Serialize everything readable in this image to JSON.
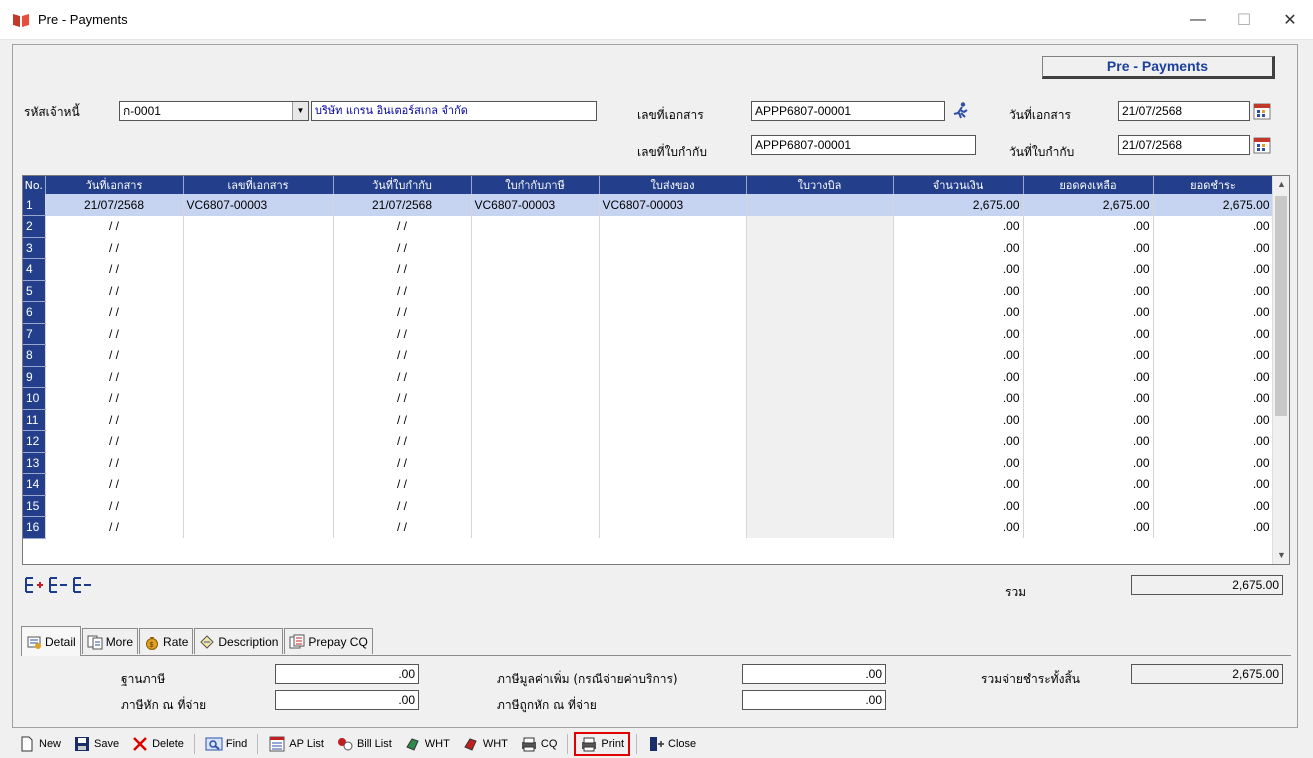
{
  "window": {
    "title": "Pre - Payments",
    "minimize": "—",
    "maximize": "☐",
    "close": "✕"
  },
  "header": {
    "badge": "Pre - Payments"
  },
  "form": {
    "creditor_code_label": "รหัสเจ้าหนี้",
    "creditor_code": "ก-0001",
    "creditor_name": "บริษัท แกรน อินเตอร์สเกล จำกัด",
    "doc_no_label": "เลขที่เอกสาร",
    "doc_no": "APPP6807-00001",
    "doc_date_label": "วันที่เอกสาร",
    "doc_date": "21/07/2568",
    "tax_inv_no_label": "เลขที่ใบกำกับ",
    "tax_inv_no": "APPP6807-00001",
    "tax_inv_date_label": "วันที่ใบกำกับ",
    "tax_inv_date": "21/07/2568"
  },
  "grid": {
    "columns": [
      "No.",
      "วันที่เอกสาร",
      "เลขที่เอกสาร",
      "วันที่ใบกำกับ",
      "ใบกำกับภาษี",
      "ใบส่งของ",
      "ใบวางบิล",
      "จำนวนเงิน",
      "ยอดคงเหลือ",
      "ยอดชำระ"
    ],
    "rows": [
      {
        "no": "1",
        "doc_date": "21/07/2568",
        "doc_no": "VC6807-00003",
        "inv_date": "21/07/2568",
        "tax_inv": "VC6807-00003",
        "delivery": "VC6807-00003",
        "bill": "",
        "amount": "2,675.00",
        "balance": "2,675.00",
        "pay": "2,675.00"
      },
      {
        "no": "2",
        "doc_date": "/ /",
        "doc_no": "",
        "inv_date": "/ /",
        "tax_inv": "",
        "delivery": "",
        "bill": "",
        "amount": ".00",
        "balance": ".00",
        "pay": ".00"
      },
      {
        "no": "3",
        "doc_date": "/ /",
        "doc_no": "",
        "inv_date": "/ /",
        "tax_inv": "",
        "delivery": "",
        "bill": "",
        "amount": ".00",
        "balance": ".00",
        "pay": ".00"
      },
      {
        "no": "4",
        "doc_date": "/ /",
        "doc_no": "",
        "inv_date": "/ /",
        "tax_inv": "",
        "delivery": "",
        "bill": "",
        "amount": ".00",
        "balance": ".00",
        "pay": ".00"
      },
      {
        "no": "5",
        "doc_date": "/ /",
        "doc_no": "",
        "inv_date": "/ /",
        "tax_inv": "",
        "delivery": "",
        "bill": "",
        "amount": ".00",
        "balance": ".00",
        "pay": ".00"
      },
      {
        "no": "6",
        "doc_date": "/ /",
        "doc_no": "",
        "inv_date": "/ /",
        "tax_inv": "",
        "delivery": "",
        "bill": "",
        "amount": ".00",
        "balance": ".00",
        "pay": ".00"
      },
      {
        "no": "7",
        "doc_date": "/ /",
        "doc_no": "",
        "inv_date": "/ /",
        "tax_inv": "",
        "delivery": "",
        "bill": "",
        "amount": ".00",
        "balance": ".00",
        "pay": ".00"
      },
      {
        "no": "8",
        "doc_date": "/ /",
        "doc_no": "",
        "inv_date": "/ /",
        "tax_inv": "",
        "delivery": "",
        "bill": "",
        "amount": ".00",
        "balance": ".00",
        "pay": ".00"
      },
      {
        "no": "9",
        "doc_date": "/ /",
        "doc_no": "",
        "inv_date": "/ /",
        "tax_inv": "",
        "delivery": "",
        "bill": "",
        "amount": ".00",
        "balance": ".00",
        "pay": ".00"
      },
      {
        "no": "10",
        "doc_date": "/ /",
        "doc_no": "",
        "inv_date": "/ /",
        "tax_inv": "",
        "delivery": "",
        "bill": "",
        "amount": ".00",
        "balance": ".00",
        "pay": ".00"
      },
      {
        "no": "11",
        "doc_date": "/ /",
        "doc_no": "",
        "inv_date": "/ /",
        "tax_inv": "",
        "delivery": "",
        "bill": "",
        "amount": ".00",
        "balance": ".00",
        "pay": ".00"
      },
      {
        "no": "12",
        "doc_date": "/ /",
        "doc_no": "",
        "inv_date": "/ /",
        "tax_inv": "",
        "delivery": "",
        "bill": "",
        "amount": ".00",
        "balance": ".00",
        "pay": ".00"
      },
      {
        "no": "13",
        "doc_date": "/ /",
        "doc_no": "",
        "inv_date": "/ /",
        "tax_inv": "",
        "delivery": "",
        "bill": "",
        "amount": ".00",
        "balance": ".00",
        "pay": ".00"
      },
      {
        "no": "14",
        "doc_date": "/ /",
        "doc_no": "",
        "inv_date": "/ /",
        "tax_inv": "",
        "delivery": "",
        "bill": "",
        "amount": ".00",
        "balance": ".00",
        "pay": ".00"
      },
      {
        "no": "15",
        "doc_date": "/ /",
        "doc_no": "",
        "inv_date": "/ /",
        "tax_inv": "",
        "delivery": "",
        "bill": "",
        "amount": ".00",
        "balance": ".00",
        "pay": ".00"
      },
      {
        "no": "16",
        "doc_date": "/ /",
        "doc_no": "",
        "inv_date": "/ /",
        "tax_inv": "",
        "delivery": "",
        "bill": "",
        "amount": ".00",
        "balance": ".00",
        "pay": ".00"
      }
    ]
  },
  "total": {
    "label": "รวม",
    "value": "2,675.00"
  },
  "tabs": [
    "Detail",
    "More",
    "Rate",
    "Description",
    "Prepay CQ"
  ],
  "detail": {
    "tax_base_label": "ฐานภาษี",
    "tax_base": ".00",
    "wht_label": "ภาษีหัก ณ ที่จ่าย",
    "wht": ".00",
    "vat_label": "ภาษีมูลค่าเพิ่ม (กรณีจ่ายค่าบริการ)",
    "vat": ".00",
    "withheld_label": "ภาษีถูกหัก ณ ที่จ่าย",
    "withheld": ".00",
    "grand_total_label": "รวมจ่ายชำระทั้งสิ้น",
    "grand_total": "2,675.00"
  },
  "toolbar": {
    "new": "New",
    "save": "Save",
    "delete": "Delete",
    "find": "Find",
    "ap_list": "AP List",
    "bill_list": "Bill List",
    "wht1": "WHT",
    "wht2": "WHT",
    "cq": "CQ",
    "print": "Print",
    "close": "Close"
  }
}
